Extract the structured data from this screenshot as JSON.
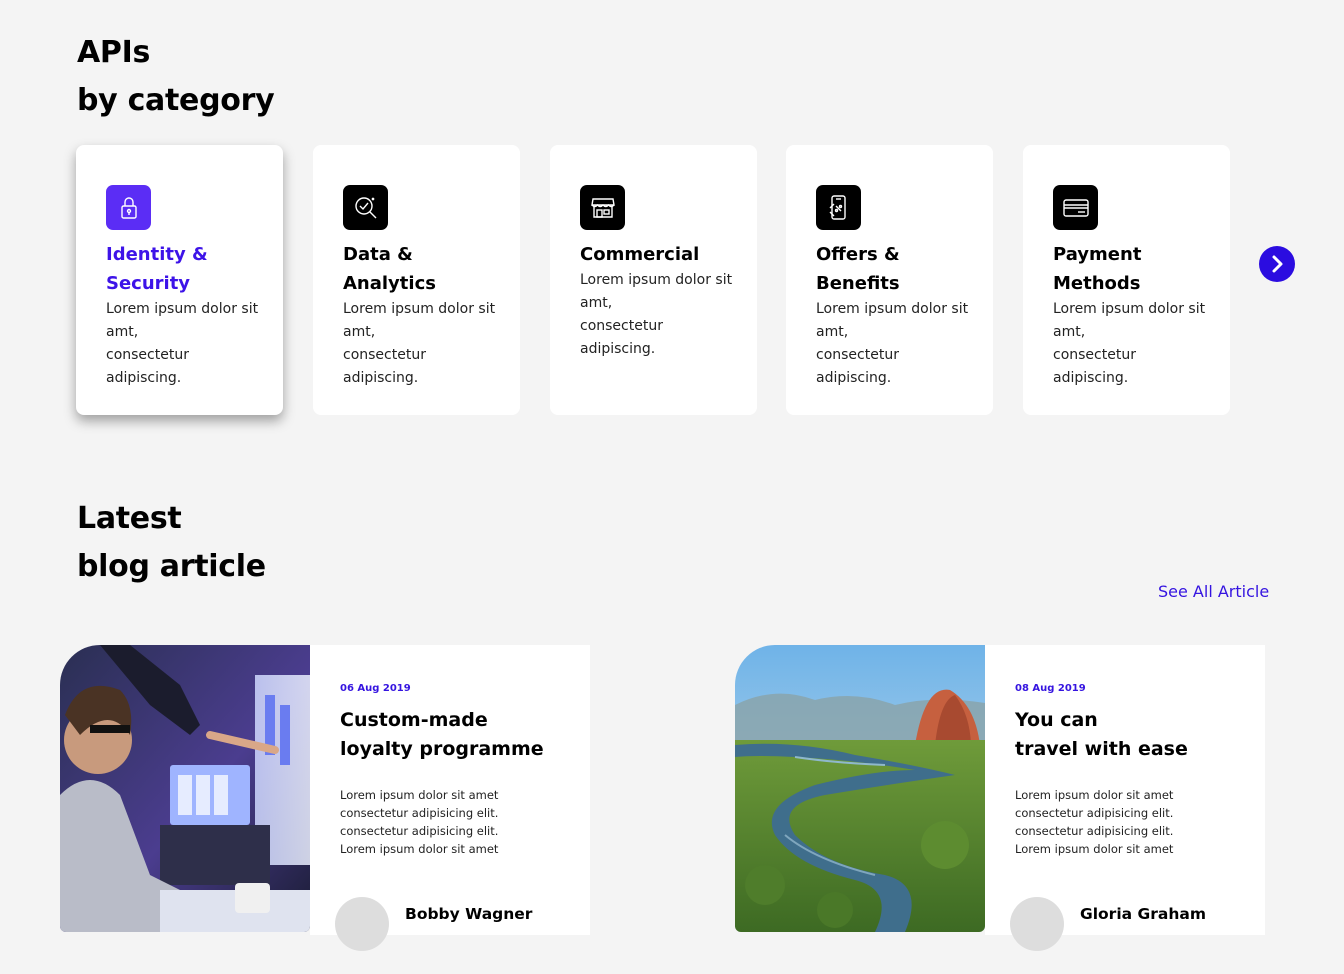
{
  "categories_section": {
    "title_line1": "APIs",
    "title_line2": "by category",
    "next_icon": "chevron-right-icon",
    "items": [
      {
        "title_line1": "Identity &",
        "title_line2": "Security",
        "desc": [
          "Lorem ipsum dolor sit",
          "amt,",
          "consectetur",
          "adipiscing."
        ],
        "icon": "lock-icon",
        "active": true
      },
      {
        "title_line1": "Data &",
        "title_line2": "Analytics",
        "desc": [
          "Lorem ipsum dolor sit",
          "amt,",
          "consectetur",
          "adipiscing."
        ],
        "icon": "analytics-search-icon"
      },
      {
        "title_line1": "Commercial",
        "title_line2": "",
        "desc": [
          "Lorem ipsum dolor sit",
          "amt,",
          "consectetur",
          "adipiscing."
        ],
        "icon": "storefront-icon"
      },
      {
        "title_line1": "Offers &",
        "title_line2": "Benefits",
        "desc": [
          "Lorem ipsum dolor sit",
          "amt,",
          "consectetur",
          "adipiscing."
        ],
        "icon": "phone-offer-icon"
      },
      {
        "title_line1": "Payment",
        "title_line2": "Methods",
        "desc": [
          "Lorem ipsum dolor sit",
          "amt,",
          "consectetur",
          "adipiscing."
        ],
        "icon": "credit-card-icon"
      }
    ]
  },
  "blog_section": {
    "title_line1": "Latest",
    "title_line2": "blog article",
    "see_all_label": "See All Article",
    "articles": [
      {
        "date": "06 Aug 2019",
        "title_line1": "Custom-made",
        "title_line2": "loyalty programme",
        "excerpt": [
          "Lorem ipsum dolor sit amet",
          "consectetur adipisicing elit.",
          "consectetur adipisicing elit.",
          "Lorem ipsum dolor sit amet"
        ],
        "author": "Bobby Wagner"
      },
      {
        "date": "08 Aug 2019",
        "title_line1": "You can",
        "title_line2": "travel with ease",
        "excerpt": [
          "Lorem ipsum dolor sit amet",
          "consectetur adipisicing elit.",
          "consectetur adipisicing elit.",
          "Lorem ipsum dolor sit amet"
        ],
        "author": "Gloria Graham"
      }
    ]
  },
  "colors": {
    "accent": "#3514e0",
    "active_icon": "#5b2df5",
    "background": "#f4f4f4"
  }
}
